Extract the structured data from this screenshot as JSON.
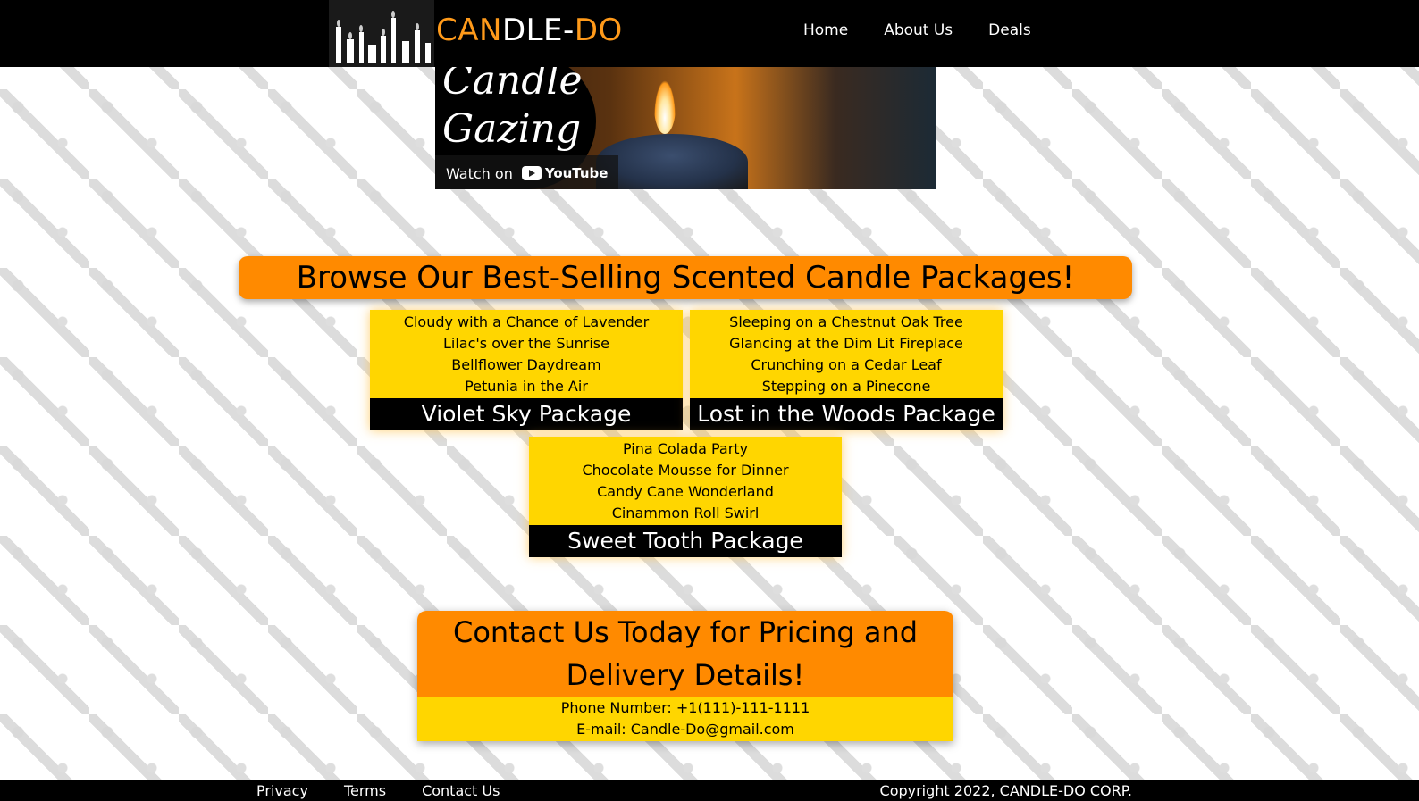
{
  "header": {
    "brand_part1": "CAN",
    "brand_part2": "DLE-",
    "brand_part3": "DO",
    "nav": [
      "Home",
      "About Us",
      "Deals"
    ]
  },
  "video": {
    "title_line1": "Candle",
    "title_line2": "Gazing",
    "watch_label": "Watch on",
    "platform": "YouTube"
  },
  "browse_heading": "Browse Our Best-Selling Scented Candle Packages!",
  "packages": [
    {
      "name": "Violet Sky Package",
      "items": [
        "Cloudy with a Chance of Lavender",
        "Lilac's over the Sunrise",
        "Bellflower Daydream",
        "Petunia in the Air"
      ]
    },
    {
      "name": "Lost in the Woods Package",
      "items": [
        "Sleeping on a Chestnut Oak Tree",
        "Glancing at the Dim Lit Fireplace",
        "Crunching on a Cedar Leaf",
        "Stepping on a Pinecone"
      ]
    },
    {
      "name": "Sweet Tooth Package",
      "items": [
        "Pina Colada Party",
        "Chocolate Mousse for Dinner",
        "Candy Cane Wonderland",
        "Cinammon Roll Swirl"
      ]
    }
  ],
  "contact": {
    "heading": "Contact Us Today for Pricing and Delivery Details!",
    "phone": "Phone Number: +1(111)-111-1111",
    "email": "E-mail: Candle-Do@gmail.com"
  },
  "footer": {
    "links": [
      "Privacy",
      "Terms",
      "Contact Us"
    ],
    "copyright": "Copyright 2022, CANDLE-DO CORP."
  },
  "colors": {
    "orange": "#ff8a00",
    "yellow": "#ffd600",
    "black": "#000000"
  }
}
